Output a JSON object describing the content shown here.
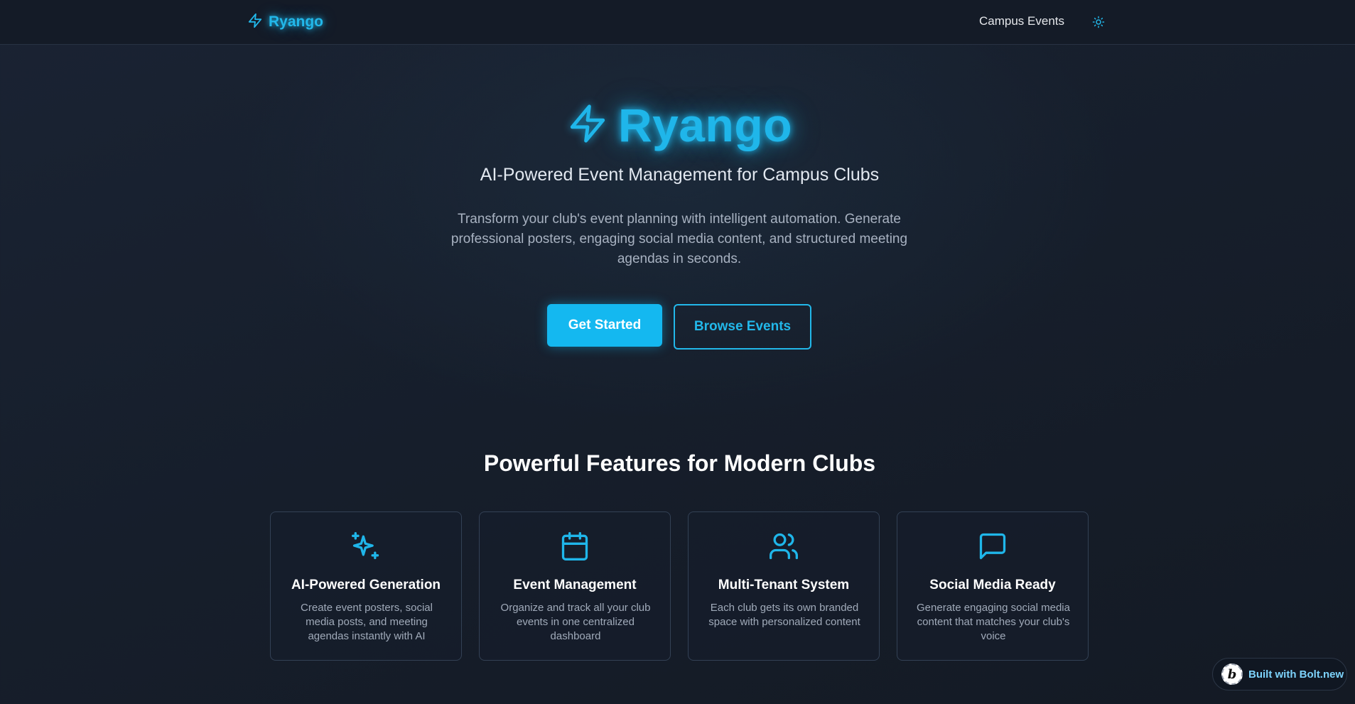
{
  "nav": {
    "brand": "Ryango",
    "link_campus_events": "Campus Events",
    "theme_icon": "sun-icon"
  },
  "hero": {
    "title": "Ryango",
    "subtitle": "AI-Powered Event Management for Campus Clubs",
    "description": "Transform your club's event planning with intelligent automation. Generate professional posters, engaging social media content, and structured meeting agendas in seconds.",
    "primary_button": "Get Started",
    "secondary_button": "Browse Events"
  },
  "features": {
    "heading": "Powerful Features for Modern Clubs",
    "items": [
      {
        "icon": "sparkles-icon",
        "title": "AI-Powered Generation",
        "description": "Create event posters, social media posts, and meeting agendas instantly with AI"
      },
      {
        "icon": "calendar-icon",
        "title": "Event Management",
        "description": "Organize and track all your club events in one centralized dashboard"
      },
      {
        "icon": "users-icon",
        "title": "Multi-Tenant System",
        "description": "Each club gets its own branded space with personalized content"
      },
      {
        "icon": "message-square-icon",
        "title": "Social Media Ready",
        "description": "Generate engaging social media content that matches your club's voice"
      }
    ]
  },
  "badge": {
    "logo_letter": "b",
    "text": "Built with Bolt.new"
  },
  "colors": {
    "accent": "#1fb6ea",
    "background": "#161e2b",
    "navbar": "#141b27",
    "card_border": "#334155"
  }
}
